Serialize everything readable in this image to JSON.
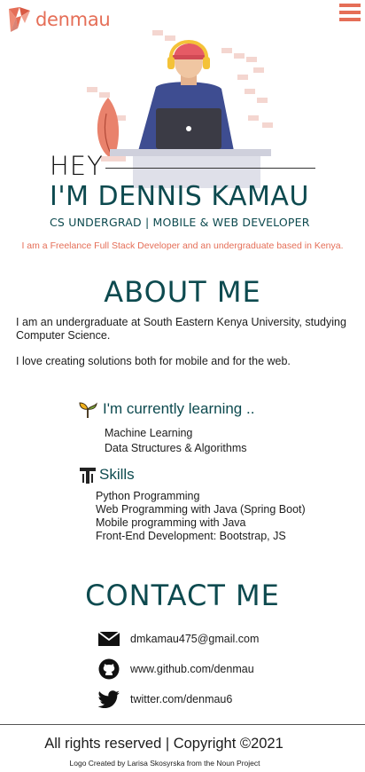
{
  "header": {
    "brand": "denmau",
    "menu_icon": "hamburger-menu-icon",
    "accent_color": "#e56e57"
  },
  "hero": {
    "greeting": "HEY",
    "name": "I'M DENNIS KAMAU",
    "role": "CS UNDERGRAD | MOBILE & WEB DEVELOPER",
    "tagline": "I am a Freelance Full Stack Developer and an undergraduate based in Kenya.",
    "illustration": "developer-at-laptop-illustration",
    "primary_color": "#0d4a4f"
  },
  "about": {
    "title": "ABOUT ME",
    "paragraphs": [
      "I am an undergraduate at South Eastern Kenya University, studying Computer Science.",
      "I love creating solutions both for mobile and for the web."
    ]
  },
  "learning": {
    "heading": "I'm currently learning ..",
    "icon": "sprout-icon",
    "items": [
      "Machine Learning",
      "Data Structures & Algorithms"
    ]
  },
  "skills": {
    "heading": "Skills",
    "icon": "tools-icon",
    "items": [
      "Python Programming",
      "Web Programming with Java (Spring Boot)",
      "Mobile programming with Java",
      "Front-End Development: Bootstrap, JS"
    ]
  },
  "contact": {
    "title": "CONTACT ME",
    "items": [
      {
        "icon": "mail-icon",
        "text": "dmkamau475@gmail.com"
      },
      {
        "icon": "github-icon",
        "text": "www.github.com/denmau"
      },
      {
        "icon": "twitter-icon",
        "text": "twitter.com/denmau6"
      }
    ]
  },
  "footer": {
    "copyright": "All rights reserved | Copyright ©2021",
    "credit": "Logo Created by Larisa Skosyrska from the Noun Project"
  }
}
